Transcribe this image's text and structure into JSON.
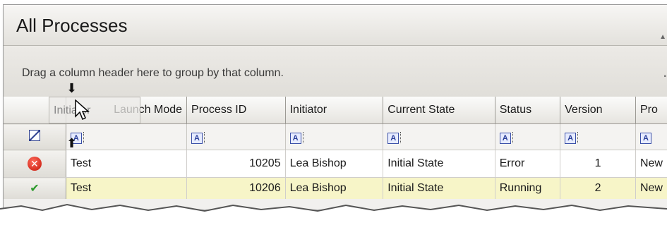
{
  "window": {
    "title": "All Processes"
  },
  "group_panel": {
    "hint": "Drag a column header here to group by that column."
  },
  "drag": {
    "ghost_label": "Initiator",
    "ghost_under_label": "Launch Mode"
  },
  "columns": [
    "Launch Mode",
    "Process ID",
    "Initiator",
    "Current State",
    "Status",
    "Version",
    "Pro"
  ],
  "filter_row": {
    "filter_glyph": "A"
  },
  "rows": [
    {
      "status_icon": "error-icon",
      "launch_mode": "Test",
      "process_id": "10205",
      "initiator": "Lea Bishop",
      "current_state": "Initial State",
      "status": "Error",
      "version": "1",
      "pro": "New"
    },
    {
      "status_icon": "ok-icon",
      "launch_mode": "Test",
      "process_id": "10206",
      "initiator": "Lea Bishop",
      "current_state": "Initial State",
      "status": "Running",
      "version": "2",
      "pro": "New"
    }
  ],
  "colors": {
    "error": "#c41508",
    "highlight_row": "#f7f5c8",
    "filter_accent": "#3a4fa8"
  }
}
